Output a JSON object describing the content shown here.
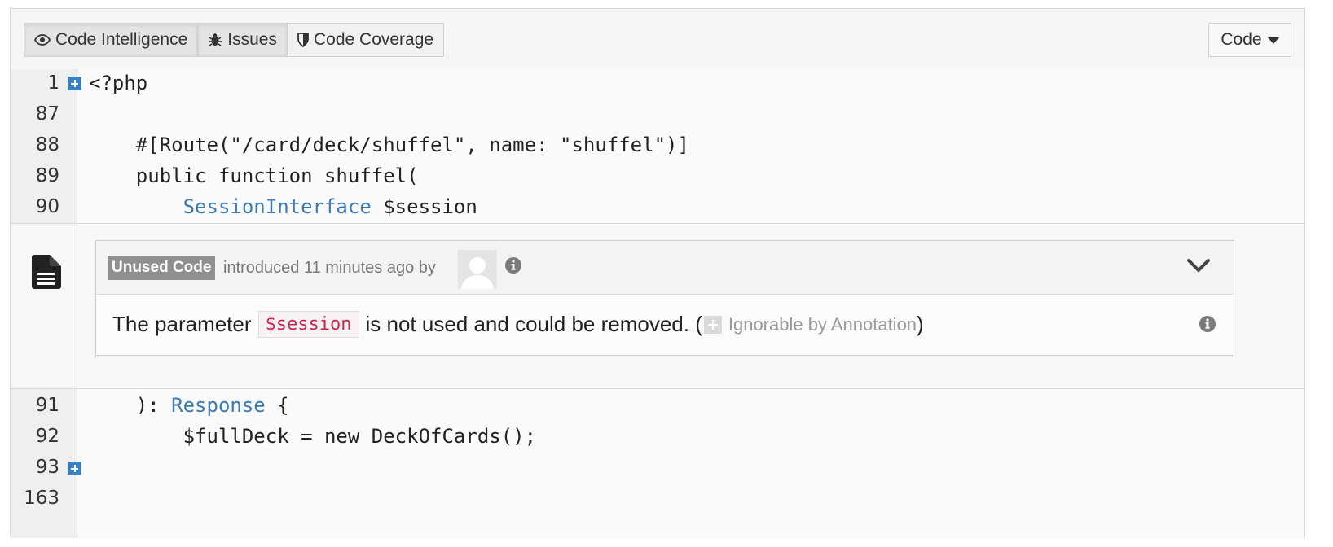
{
  "toolbar": {
    "tabs": [
      {
        "label": "Code Intelligence",
        "icon": "eye-icon"
      },
      {
        "label": "Issues",
        "icon": "bug-icon"
      },
      {
        "label": "Code Coverage",
        "icon": "shield-icon"
      }
    ],
    "code_button_label": "Code"
  },
  "code_top": [
    {
      "num": "1",
      "text": "<?php",
      "expandable": true
    },
    {
      "num": "87",
      "text": "",
      "expandable": false
    },
    {
      "num": "88",
      "text": "    #[Route(\"/card/deck/shuffel\", name: \"shuffel\")]",
      "expandable": false
    },
    {
      "num": "89",
      "text": "    public function shuffel(",
      "expandable": false
    },
    {
      "num": "90",
      "indent": "        ",
      "type": "SessionInterface",
      "rest": " $session",
      "expandable": false
    }
  ],
  "issue": {
    "badge": "Unused Code",
    "meta": "introduced 11 minutes ago by",
    "message_before": "The parameter",
    "variable": "$session",
    "message_after": "is not used and could be removed. (",
    "ignorable_label": "Ignorable by Annotation",
    "closing_paren": ")"
  },
  "code_bottom": [
    {
      "num": "91",
      "prefix": "    ): ",
      "type": "Response",
      "rest": " {",
      "expandable": false
    },
    {
      "num": "92",
      "text": "        $fullDeck = new DeckOfCards();",
      "expandable": false
    },
    {
      "num": "93",
      "text": "",
      "expandable": true
    },
    {
      "num": "163",
      "text": "",
      "expandable": false
    }
  ],
  "colors": {
    "expand_blue": "#3a7fc1",
    "type_blue": "#3a7bb5",
    "badge_gray": "#8f8f8f",
    "code_var": "#c7254e"
  }
}
